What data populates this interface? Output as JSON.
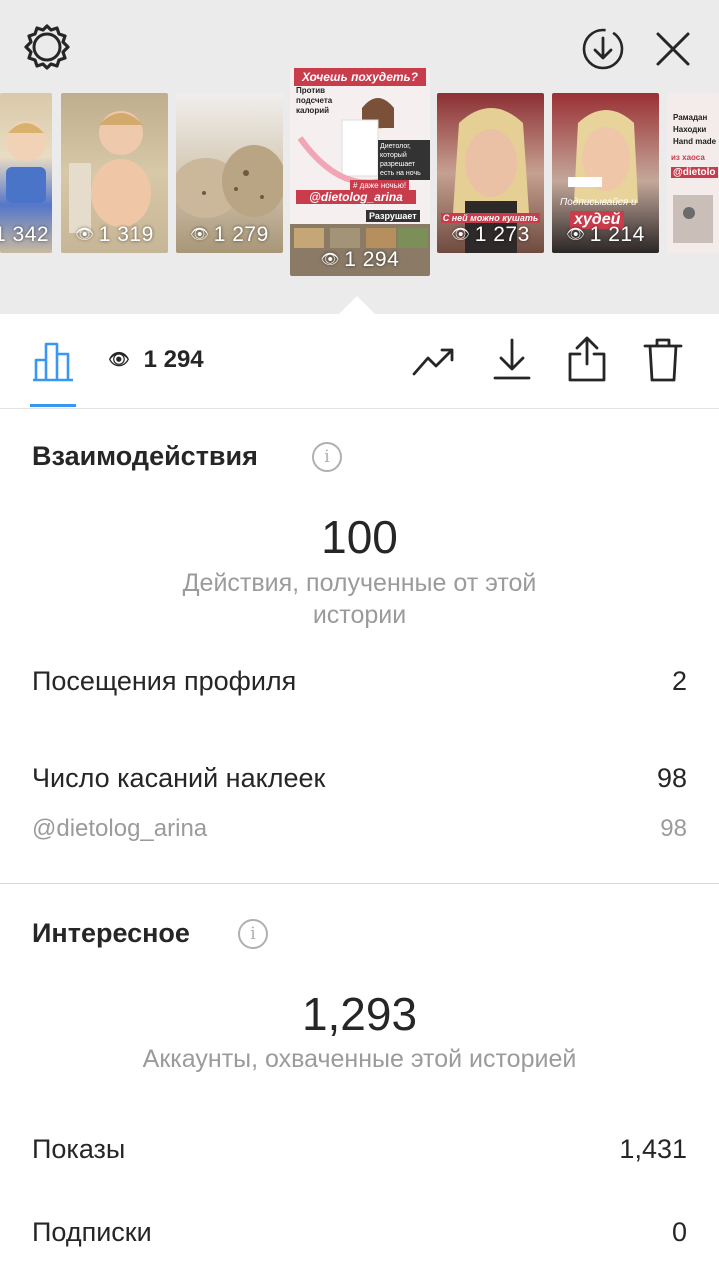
{
  "colors": {
    "accent": "#3897f0",
    "text": "#262626",
    "muted": "#9b9b9b",
    "topbar_bg": "#ebebeb"
  },
  "top_bar": {
    "settings_icon": "gear-icon",
    "download_icon": "download-circle-icon",
    "close_icon": "close-icon"
  },
  "stories": [
    {
      "views": "1 342",
      "thumb": "baby-in-high-chair"
    },
    {
      "views": "1 319",
      "thumb": "baby-sitting"
    },
    {
      "views": "1 279",
      "thumb": "dessert-close-up"
    },
    {
      "views": "1 294",
      "thumb": "text-promo-story",
      "selected": true,
      "texts": [
        "Хочешь похудеть?",
        "Против подсчета калорий",
        "Диетолог, который разрешает есть на ночь",
        "# даже ночью!",
        "@dietolog_arina",
        "Разрушает"
      ]
    },
    {
      "views": "1 273",
      "thumb": "woman-selfie",
      "texts": [
        "С ней можно кушать"
      ]
    },
    {
      "views": "1 214",
      "thumb": "woman-selfie-2",
      "texts": [
        "Подписывайся и",
        "худей"
      ]
    },
    {
      "views": "",
      "thumb": "list-story",
      "texts": [
        "Рамадан",
        "Находки",
        "Hand made",
        "из хаоса",
        "@dietolo"
      ]
    }
  ],
  "toolbar": {
    "insights_icon": "bar-chart-icon",
    "views_icon": "eye-icon",
    "views": "1 294",
    "promote_icon": "trending-icon",
    "save_icon": "download-icon",
    "share_icon": "share-icon",
    "delete_icon": "trash-icon"
  },
  "interactions": {
    "title": "Взаимодействия",
    "total": "100",
    "caption": "Действия, полученные от этой истории",
    "rows": [
      {
        "label": "Посещения профиля",
        "value": "2"
      },
      {
        "label": "Число касаний наклеек",
        "value": "98"
      }
    ],
    "sub_rows": [
      {
        "label": "@dietolog_arina",
        "value": "98"
      }
    ]
  },
  "discovery": {
    "title": "Интересное",
    "total": "1,293",
    "caption": "Аккаунты, охваченные этой историей",
    "rows": [
      {
        "label": "Показы",
        "value": "1,431"
      },
      {
        "label": "Подписки",
        "value": "0"
      }
    ]
  }
}
